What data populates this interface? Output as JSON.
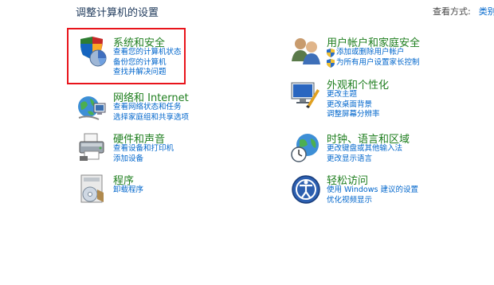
{
  "page": {
    "title": "调整计算机的设置",
    "view_by_label": "查看方式:",
    "view_by_value": "类别"
  },
  "categories": [
    {
      "name": "系统和安全",
      "links": [
        "查看您的计算机状态",
        "备份您的计算机",
        "查找并解决问题"
      ]
    },
    {
      "name": "网络和 Internet",
      "links": [
        "查看网络状态和任务",
        "选择家庭组和共享选项"
      ]
    },
    {
      "name": "硬件和声音",
      "links": [
        "查看设备和打印机",
        "添加设备"
      ]
    },
    {
      "name": "程序",
      "links": [
        "卸载程序"
      ]
    },
    {
      "name": "用户帐户和家庭安全",
      "links": [
        "添加或删除用户帐户",
        "为所有用户设置家长控制"
      ]
    },
    {
      "name": "外观和个性化",
      "links": [
        "更改主题",
        "更改桌面背景",
        "调整屏幕分辨率"
      ]
    },
    {
      "name": "时钟、语言和区域",
      "links": [
        "更改键盘或其他输入法",
        "更改显示语言"
      ]
    },
    {
      "name": "轻松访问",
      "links": [
        "使用 Windows 建议的设置",
        "优化视频显示"
      ]
    }
  ],
  "colors": {
    "heading": "#1e7e1e",
    "link": "#0066cc",
    "title": "#1e395b",
    "highlight": "#e8141b"
  },
  "icons": [
    "shield-pie-icon",
    "network-globe-icon",
    "printer-icon",
    "programs-icon",
    "users-icon",
    "monitor-paint-icon",
    "clock-globe-icon",
    "accessibility-icon"
  ]
}
